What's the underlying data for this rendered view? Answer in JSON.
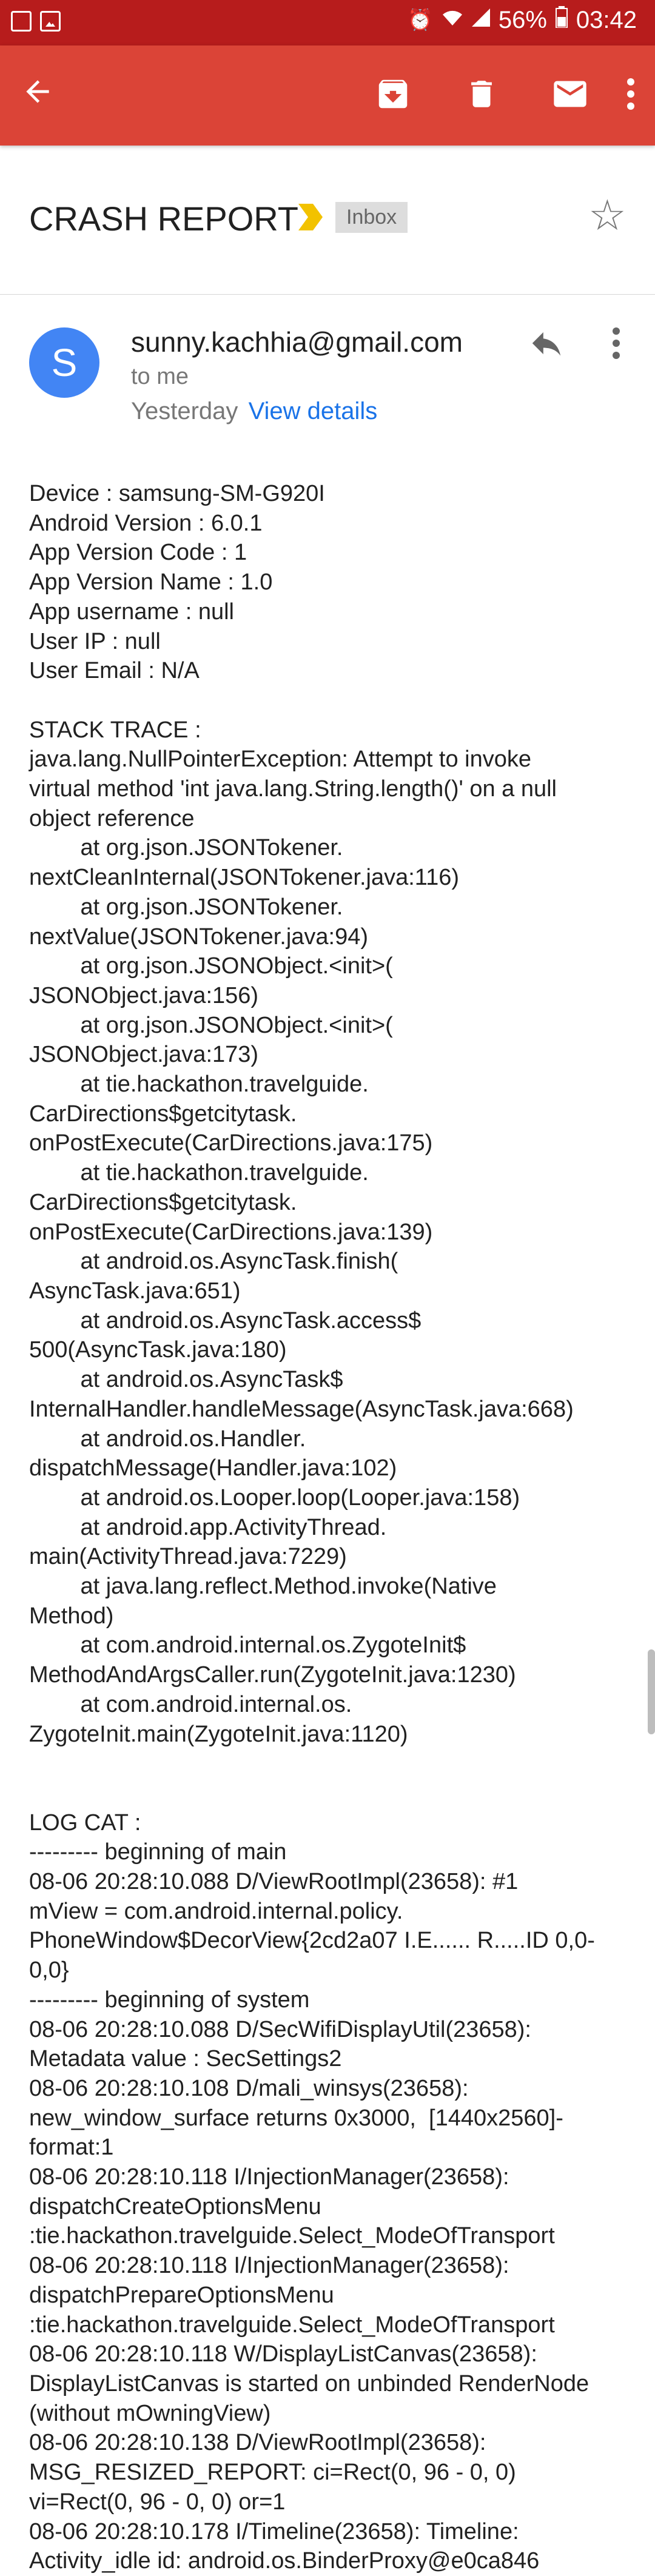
{
  "status_bar": {
    "battery": "56%",
    "time": "03:42",
    "background_color": "#b71c1c"
  },
  "toolbar": {
    "background_color": "#db4437",
    "icons": [
      "back-arrow-icon",
      "archive-icon",
      "delete-icon",
      "mail-icon",
      "more-vert-icon"
    ]
  },
  "email": {
    "subject": "CRASH REPORT",
    "label": "Inbox",
    "sender_initial": "S",
    "sender": "sunny.kachhia@gmail.com",
    "recipient": "to me",
    "date": "Yesterday",
    "view_details": "View details",
    "avatar_color": "#4285f4",
    "link_color": "#1a73e8",
    "body_lines": [
      "Device : samsung-SM-G920I",
      "Android Version : 6.0.1",
      "App Version Code : 1",
      "App Version Name : 1.0",
      "App username : null",
      "User IP : null",
      "User Email : N/A",
      "",
      "STACK TRACE :",
      "java.lang.NullPointerException: Attempt to invoke",
      "virtual method 'int java.lang.String.length()' on a null",
      "object reference",
      "        at org.json.JSONTokener.",
      "nextCleanInternal(JSONTokener.java:116)",
      "        at org.json.JSONTokener.",
      "nextValue(JSONTokener.java:94)",
      "        at org.json.JSONObject.<init>(",
      "JSONObject.java:156)",
      "        at org.json.JSONObject.<init>(",
      "JSONObject.java:173)",
      "        at tie.hackathon.travelguide.",
      "CarDirections$getcitytask.",
      "onPostExecute(CarDirections.java:175)",
      "        at tie.hackathon.travelguide.",
      "CarDirections$getcitytask.",
      "onPostExecute(CarDirections.java:139)",
      "        at android.os.AsyncTask.finish(",
      "AsyncTask.java:651)",
      "        at android.os.AsyncTask.access$",
      "500(AsyncTask.java:180)",
      "        at android.os.AsyncTask$",
      "InternalHandler.handleMessage(AsyncTask.java:668)",
      "        at android.os.Handler.",
      "dispatchMessage(Handler.java:102)",
      "        at android.os.Looper.loop(Looper.java:158)",
      "        at android.app.ActivityThread.",
      "main(ActivityThread.java:7229)",
      "        at java.lang.reflect.Method.invoke(Native",
      "Method)",
      "        at com.android.internal.os.ZygoteInit$",
      "MethodAndArgsCaller.run(ZygoteInit.java:1230)",
      "        at com.android.internal.os.",
      "ZygoteInit.main(ZygoteInit.java:1120)",
      "",
      "",
      "LOG CAT :",
      "--------- beginning of main",
      "08-06 20:28:10.088 D/ViewRootImpl(23658): #1",
      "mView = com.android.internal.policy.",
      "PhoneWindow$DecorView{2cd2a07 I.E...... R.....ID 0,0-",
      "0,0}",
      "--------- beginning of system",
      "08-06 20:28:10.088 D/SecWifiDisplayUtil(23658):",
      "Metadata value : SecSettings2",
      "08-06 20:28:10.108 D/mali_winsys(23658):",
      "new_window_surface returns 0x3000,  [1440x2560]-",
      "format:1",
      "08-06 20:28:10.118 I/InjectionManager(23658):",
      "dispatchCreateOptionsMenu",
      ":tie.hackathon.travelguide.Select_ModeOfTransport",
      "08-06 20:28:10.118 I/InjectionManager(23658):",
      "dispatchPrepareOptionsMenu",
      ":tie.hackathon.travelguide.Select_ModeOfTransport",
      "08-06 20:28:10.118 W/DisplayListCanvas(23658):",
      "DisplayListCanvas is started on unbinded RenderNode",
      "(without mOwningView)",
      "08-06 20:28:10.138 D/ViewRootImpl(23658):",
      "MSG_RESIZED_REPORT: ci=Rect(0, 96 - 0, 0)",
      "vi=Rect(0, 96 - 0, 0) or=1",
      "08-06 20:28:10.178 I/Timeline(23658): Timeline:",
      "Activity_idle id: android.os.BinderProxy@e0ca846"
    ]
  }
}
